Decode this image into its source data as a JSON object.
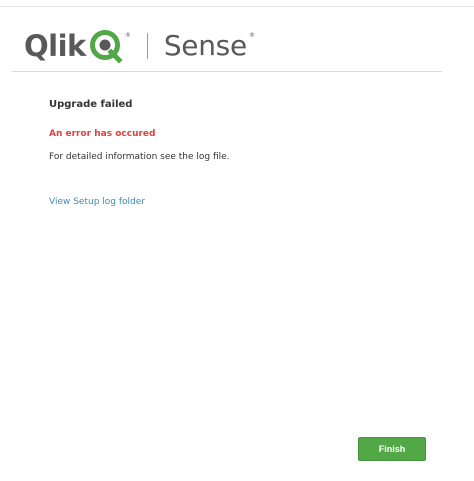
{
  "brand": {
    "logo_word": "Qlik",
    "product_name": "Sense",
    "registered_mark": "®",
    "logo_green": "#52a847",
    "logo_gray": "#595959"
  },
  "status": {
    "title": "Upgrade failed",
    "error_message": "An error has occured",
    "detail_message": "For detailed information see the log file.",
    "error_color": "#dc423f"
  },
  "links": {
    "view_log_label": "View Setup log folder",
    "link_color": "#3f8ab3"
  },
  "footer": {
    "finish_label": "Finish",
    "button_color": "#52a847"
  }
}
